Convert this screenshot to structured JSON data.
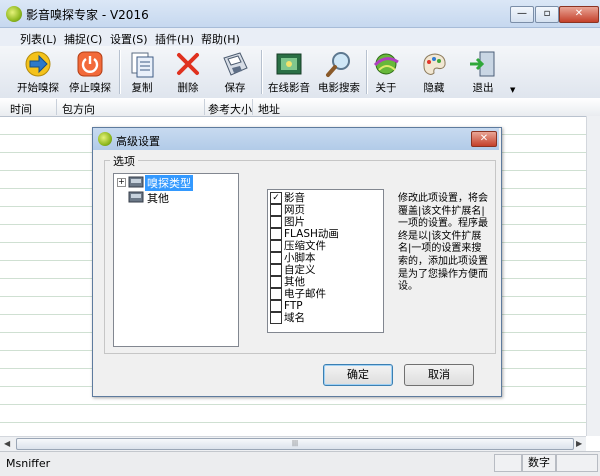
{
  "window": {
    "title": "影音嗅探专家 - V2016"
  },
  "menu": [
    "列表(L)",
    "捕捉(C)",
    "设置(S)",
    "插件(H)",
    "帮助(H)"
  ],
  "toolbar": [
    {
      "label": "开始嗅探",
      "icon": "start-arrow-icon"
    },
    {
      "label": "停止嗅探",
      "icon": "stop-power-icon"
    },
    {
      "label": "复制",
      "icon": "copy-document-icon"
    },
    {
      "label": "删除",
      "icon": "delete-x-icon"
    },
    {
      "label": "保存",
      "icon": "save-disk-icon"
    },
    {
      "label": "在线影音",
      "icon": "film-icon"
    },
    {
      "label": "电影搜索",
      "icon": "magnifier-icon"
    },
    {
      "label": "关于",
      "icon": "globe-about-icon"
    },
    {
      "label": "隐藏",
      "icon": "palette-hide-icon"
    },
    {
      "label": "退出",
      "icon": "exit-door-icon"
    }
  ],
  "columns": [
    "时间",
    "包方向",
    "参考大小",
    "地址"
  ],
  "status": {
    "text": "Msniffer",
    "numlock": "数字"
  },
  "dialog": {
    "title": "高级设置",
    "group_label": "选项",
    "tree": [
      "嗅探类型",
      "其他"
    ],
    "checklist": [
      {
        "label": "影音",
        "checked": true
      },
      {
        "label": "网页",
        "checked": false
      },
      {
        "label": "图片",
        "checked": false
      },
      {
        "label": "FLASH动画",
        "checked": false
      },
      {
        "label": "压缩文件",
        "checked": false
      },
      {
        "label": "小脚本",
        "checked": false
      },
      {
        "label": "自定义",
        "checked": false
      },
      {
        "label": "其他",
        "checked": false
      },
      {
        "label": "电子邮件",
        "checked": false
      },
      {
        "label": "FTP",
        "checked": false
      },
      {
        "label": "域名",
        "checked": false
      }
    ],
    "description": "修改此项设置，将会覆盖|该文件扩展名|一项的设置。程序最终是以|该文件扩展名|一项的设置来搜索的，添加此项设置是为了您操作方便而设。",
    "ok": "确定",
    "cancel": "取消"
  }
}
